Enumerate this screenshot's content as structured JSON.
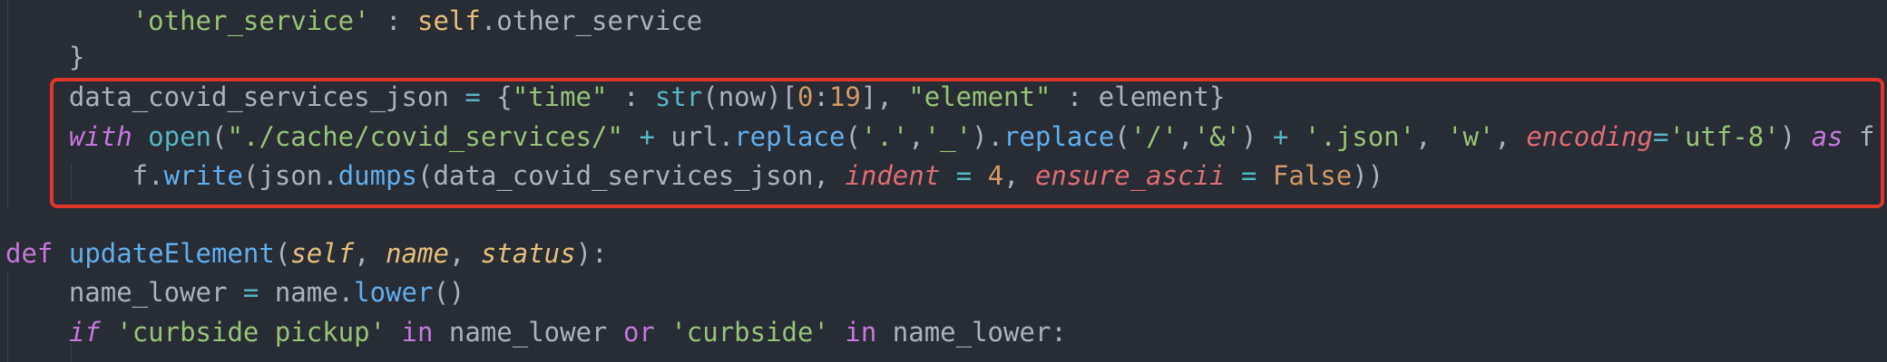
{
  "editor": {
    "theme_colors": {
      "background": "#282c34",
      "highlight_box": "#e0352b"
    },
    "lines": [
      {
        "tokens": [
          {
            "cls": "plain",
            "text": "        "
          },
          {
            "cls": "str",
            "text": "'other_service'"
          },
          {
            "cls": "plain",
            "text": " : "
          },
          {
            "cls": "self",
            "text": "self"
          },
          {
            "cls": "plain",
            "text": ".other_service"
          }
        ]
      },
      {
        "tokens": [
          {
            "cls": "plain",
            "text": "    }"
          }
        ]
      },
      {
        "tokens": [
          {
            "cls": "plain",
            "text": "    data_covid_services_json "
          },
          {
            "cls": "op",
            "text": "="
          },
          {
            "cls": "plain",
            "text": " {"
          },
          {
            "cls": "str",
            "text": "\"time\""
          },
          {
            "cls": "plain",
            "text": " : "
          },
          {
            "cls": "bi",
            "text": "str"
          },
          {
            "cls": "plain",
            "text": "(now)["
          },
          {
            "cls": "num",
            "text": "0"
          },
          {
            "cls": "plain",
            "text": ":"
          },
          {
            "cls": "num",
            "text": "19"
          },
          {
            "cls": "plain",
            "text": "], "
          },
          {
            "cls": "str",
            "text": "\"element\""
          },
          {
            "cls": "plain",
            "text": " : element}"
          }
        ]
      },
      {
        "tokens": [
          {
            "cls": "plain",
            "text": "    "
          },
          {
            "cls": "kwi",
            "text": "with"
          },
          {
            "cls": "plain",
            "text": " "
          },
          {
            "cls": "bi",
            "text": "open"
          },
          {
            "cls": "plain",
            "text": "("
          },
          {
            "cls": "str",
            "text": "\"./cache/covid_services/\""
          },
          {
            "cls": "plain",
            "text": " "
          },
          {
            "cls": "op",
            "text": "+"
          },
          {
            "cls": "plain",
            "text": " url."
          },
          {
            "cls": "fn",
            "text": "replace"
          },
          {
            "cls": "plain",
            "text": "("
          },
          {
            "cls": "str",
            "text": "'.'"
          },
          {
            "cls": "plain",
            "text": ","
          },
          {
            "cls": "str",
            "text": "'_'"
          },
          {
            "cls": "plain",
            "text": ")."
          },
          {
            "cls": "fn",
            "text": "replace"
          },
          {
            "cls": "plain",
            "text": "("
          },
          {
            "cls": "str",
            "text": "'/'"
          },
          {
            "cls": "plain",
            "text": ","
          },
          {
            "cls": "str",
            "text": "'&'"
          },
          {
            "cls": "plain",
            "text": ") "
          },
          {
            "cls": "op",
            "text": "+"
          },
          {
            "cls": "plain",
            "text": " "
          },
          {
            "cls": "str",
            "text": "'.json'"
          },
          {
            "cls": "plain",
            "text": ", "
          },
          {
            "cls": "str",
            "text": "'w'"
          },
          {
            "cls": "plain",
            "text": ", "
          },
          {
            "cls": "kwarg",
            "text": "encoding"
          },
          {
            "cls": "op",
            "text": "="
          },
          {
            "cls": "str",
            "text": "'utf-8'"
          },
          {
            "cls": "plain",
            "text": ") "
          },
          {
            "cls": "kwi",
            "text": "as"
          },
          {
            "cls": "plain",
            "text": " f:"
          }
        ]
      },
      {
        "tokens": [
          {
            "cls": "plain",
            "text": "        f."
          },
          {
            "cls": "fn",
            "text": "write"
          },
          {
            "cls": "plain",
            "text": "(json."
          },
          {
            "cls": "fn",
            "text": "dumps"
          },
          {
            "cls": "plain",
            "text": "(data_covid_services_json, "
          },
          {
            "cls": "kwarg",
            "text": "indent"
          },
          {
            "cls": "plain",
            "text": " "
          },
          {
            "cls": "op",
            "text": "="
          },
          {
            "cls": "plain",
            "text": " "
          },
          {
            "cls": "num",
            "text": "4"
          },
          {
            "cls": "plain",
            "text": ", "
          },
          {
            "cls": "kwarg",
            "text": "ensure_ascii"
          },
          {
            "cls": "plain",
            "text": " "
          },
          {
            "cls": "op",
            "text": "="
          },
          {
            "cls": "plain",
            "text": " "
          },
          {
            "cls": "bool",
            "text": "False"
          },
          {
            "cls": "plain",
            "text": "))"
          }
        ]
      },
      {
        "tokens": []
      },
      {
        "tokens": [
          {
            "cls": "kw",
            "text": "def"
          },
          {
            "cls": "plain",
            "text": " "
          },
          {
            "cls": "fn",
            "text": "updateElement"
          },
          {
            "cls": "plain",
            "text": "("
          },
          {
            "cls": "par",
            "text": "self"
          },
          {
            "cls": "plain",
            "text": ", "
          },
          {
            "cls": "par",
            "text": "name"
          },
          {
            "cls": "plain",
            "text": ", "
          },
          {
            "cls": "par",
            "text": "status"
          },
          {
            "cls": "plain",
            "text": "):"
          }
        ]
      },
      {
        "tokens": [
          {
            "cls": "plain",
            "text": "    name_lower "
          },
          {
            "cls": "op",
            "text": "="
          },
          {
            "cls": "plain",
            "text": " name."
          },
          {
            "cls": "fn",
            "text": "lower"
          },
          {
            "cls": "plain",
            "text": "()"
          }
        ]
      },
      {
        "tokens": [
          {
            "cls": "plain",
            "text": "    "
          },
          {
            "cls": "kwi",
            "text": "if"
          },
          {
            "cls": "plain",
            "text": " "
          },
          {
            "cls": "str",
            "text": "'curbside pickup'"
          },
          {
            "cls": "plain",
            "text": " "
          },
          {
            "cls": "kw",
            "text": "in"
          },
          {
            "cls": "plain",
            "text": " name_lower "
          },
          {
            "cls": "kw",
            "text": "or"
          },
          {
            "cls": "plain",
            "text": " "
          },
          {
            "cls": "str",
            "text": "'curbside'"
          },
          {
            "cls": "plain",
            "text": " "
          },
          {
            "cls": "kw",
            "text": "in"
          },
          {
            "cls": "plain",
            "text": " name_lower:"
          }
        ]
      }
    ]
  }
}
